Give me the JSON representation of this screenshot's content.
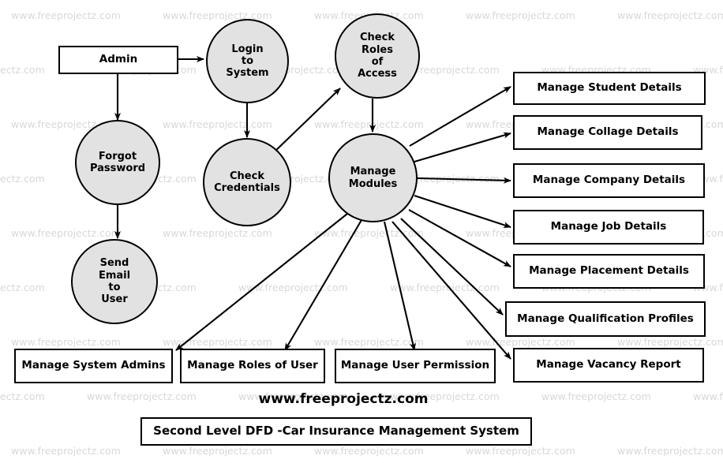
{
  "diagram": {
    "title_caption": "Second Level DFD -Car Insurance Management System",
    "site_label": "www.freeprojectz.com",
    "watermark_text": "www.freeprojectz.com",
    "colors": {
      "process_fill": "#e2e2e2",
      "stroke": "#000000",
      "entity_fill": "#ffffff",
      "watermark": "#d8d8d8",
      "background": "#ffffff"
    },
    "nodes": {
      "admin": {
        "label": "Admin",
        "type": "entity",
        "shape": "rect"
      },
      "login_to_system": {
        "label": "Login to System",
        "lines": [
          "Login",
          "to",
          "System"
        ],
        "type": "process",
        "shape": "circle"
      },
      "check_roles_of_access": {
        "label": "Check Roles of Access",
        "lines": [
          "Check",
          "Roles",
          "of",
          "Access"
        ],
        "type": "process",
        "shape": "circle"
      },
      "forgot_password": {
        "label": "Forgot Password",
        "lines": [
          "Forgot",
          "Password"
        ],
        "type": "process",
        "shape": "circle"
      },
      "check_credentials": {
        "label": "Check Credentials",
        "lines": [
          "Check",
          "Credentials"
        ],
        "type": "process",
        "shape": "circle"
      },
      "manage_modules": {
        "label": "Manage Modules",
        "lines": [
          "Manage",
          "Modules"
        ],
        "type": "process",
        "shape": "circle"
      },
      "send_email_to_user": {
        "label": "Send Email to User",
        "lines": [
          "Send",
          "Email",
          "to",
          "User"
        ],
        "type": "process",
        "shape": "circle"
      }
    },
    "right_stores": [
      {
        "label": "Manage Student Details"
      },
      {
        "label": "Manage Collage Details"
      },
      {
        "label": "Manage Company Details"
      },
      {
        "label": "Manage Job Details"
      },
      {
        "label": "Manage Placement Details"
      },
      {
        "label": "Manage Qualification Profiles"
      },
      {
        "label": "Manage Vacancy Report"
      }
    ],
    "bottom_stores": [
      {
        "label": "Manage System Admins"
      },
      {
        "label": "Manage Roles of User"
      },
      {
        "label": "Manage User Permission"
      }
    ]
  }
}
